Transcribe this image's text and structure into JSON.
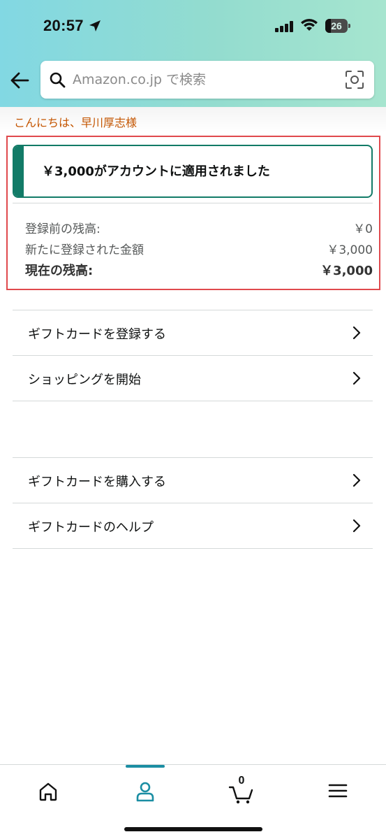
{
  "status_bar": {
    "time": "20:57",
    "battery": "26",
    "battery_level_percent": 26
  },
  "search": {
    "placeholder": "Amazon.co.jp で検索"
  },
  "greeting": "こんにちは、早川厚志様",
  "alert": {
    "message": "￥3,000がアカウントに適用されました",
    "color": "#127b67"
  },
  "balance": {
    "rows": [
      {
        "label": "登録前の残高:",
        "value": "￥0"
      },
      {
        "label": "新たに登録された金額",
        "value": "￥3,000"
      },
      {
        "label": "現在の残高:",
        "value": "￥3,000"
      }
    ]
  },
  "menu_group_1": [
    {
      "label": "ギフトカードを登録する"
    },
    {
      "label": "ショッピングを開始"
    }
  ],
  "menu_group_2": [
    {
      "label": "ギフトカードを購入する"
    },
    {
      "label": "ギフトカードのヘルプ"
    }
  ],
  "bottom_nav": {
    "items": [
      {
        "icon": "home-icon"
      },
      {
        "icon": "account-icon",
        "active": true
      },
      {
        "icon": "cart-icon",
        "count": "0"
      },
      {
        "icon": "menu-icon"
      }
    ],
    "active_color": "#1b8ea3"
  },
  "colors": {
    "greeting": "#c45500",
    "highlight_border": "#e0494d"
  }
}
